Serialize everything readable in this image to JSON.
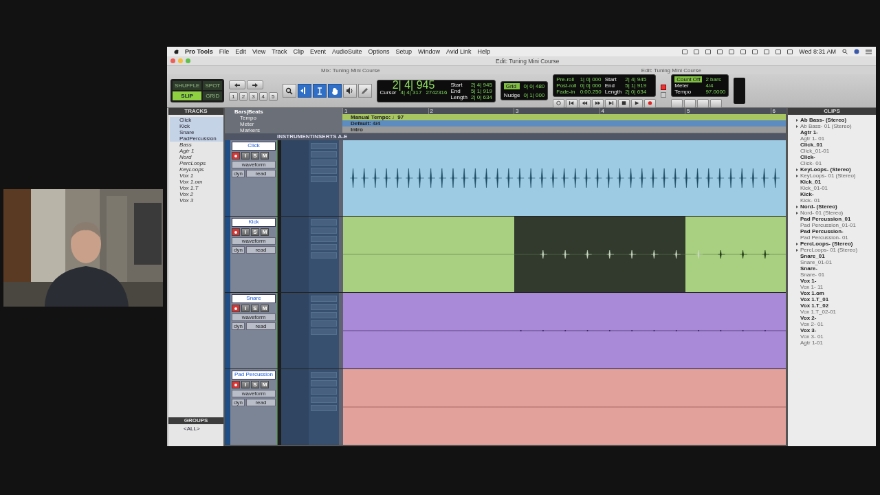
{
  "menubar": {
    "app": "Pro Tools",
    "menus": [
      "File",
      "Edit",
      "View",
      "Track",
      "Clip",
      "Event",
      "AudioSuite",
      "Options",
      "Setup",
      "Window",
      "Avid Link",
      "Help"
    ],
    "clock": "Wed 8:31 AM"
  },
  "window": {
    "title": "Edit: Tuning Mini Course",
    "mix_title": "Mix: Tuning Mini Course",
    "edit_title": "Edit: Tuning Mini Course"
  },
  "toolbar": {
    "modes": [
      {
        "label": "SHUFFLE",
        "selected": false
      },
      {
        "label": "SPOT",
        "selected": false
      },
      {
        "label": "SLIP",
        "selected": true
      },
      {
        "label": "GRID",
        "selected": false
      }
    ],
    "zoom_presets": [
      "1",
      "2",
      "3",
      "4",
      "5"
    ],
    "tools": [
      {
        "kind": "zoom",
        "selected": false
      },
      {
        "kind": "trim",
        "selected": true
      },
      {
        "kind": "selector",
        "selected": true
      },
      {
        "kind": "grabber",
        "selected": true
      },
      {
        "kind": "scrub",
        "selected": false
      },
      {
        "kind": "pencil",
        "selected": false
      }
    ],
    "counter": {
      "main": "2| 4| 945",
      "start_label": "Start",
      "end_label": "End",
      "length_label": "Length",
      "start": "2| 4| 945",
      "end": "5| 1| 919",
      "length": "2| 0| 634",
      "cursor_label": "Cursor",
      "cursor": "4| 4| 317",
      "samples": "2742316"
    },
    "grid": {
      "grid_label": "Grid",
      "grid_on": true,
      "grid": "0| 0| 480",
      "nudge_label": "Nudge",
      "nudge": "0| 1| 000"
    },
    "transport": {
      "preroll_label": "Pre-roll",
      "preroll": "1| 0| 000",
      "postroll_label": "Post-roll",
      "postroll": "0| 0| 000",
      "fadein_label": "Fade-in",
      "fadein": "0:00.250",
      "start_label": "Start",
      "start": "2| 4| 945",
      "end_label": "End",
      "end": "5| 1| 919",
      "length_label": "Length",
      "length": "2| 0| 634"
    },
    "midi": {
      "countoff_label": "Count Off",
      "countoff": "2 bars",
      "meter_label": "Meter",
      "meter": "4/4",
      "tempo_label": "Tempo",
      "tempo": "97.0000"
    }
  },
  "tracks_panel": {
    "title": "TRACKS",
    "items": [
      {
        "name": "Click",
        "selected": true
      },
      {
        "name": "Kick",
        "selected": true
      },
      {
        "name": "Snare",
        "selected": true
      },
      {
        "name": "PadPercussion",
        "selected": true
      },
      {
        "name": "Bass",
        "selected": false
      },
      {
        "name": "Agtr 1",
        "selected": false
      },
      {
        "name": "Nord",
        "selected": false
      },
      {
        "name": "PercLoops",
        "selected": false
      },
      {
        "name": "KeyLoops",
        "selected": false
      },
      {
        "name": "Vox 1",
        "selected": false
      },
      {
        "name": "Vox 1.om",
        "selected": false
      },
      {
        "name": "Vox 1.T",
        "selected": false
      },
      {
        "name": "Vox 2",
        "selected": false
      },
      {
        "name": "Vox 3",
        "selected": false
      }
    ]
  },
  "groups_panel": {
    "title": "GROUPS",
    "items": [
      "<ALL>"
    ]
  },
  "rulers": {
    "labels": [
      "Bars|Beats",
      "Tempo",
      "Meter",
      "Markers"
    ],
    "bars": [
      "1",
      "2",
      "3",
      "4",
      "5",
      "6"
    ],
    "tempo_marker": "Manual Tempo: ♩97",
    "meter_marker": "Default: 4/4",
    "marker": "Intro"
  },
  "columns": [
    "INSTRUMENT",
    "INSERTS A-E"
  ],
  "tracks": [
    {
      "name": "Click",
      "color": "#9dcbe3",
      "kind": "click",
      "view": "waveform",
      "automation": "dyn",
      "mode": "read",
      "buttons": [
        "I",
        "S",
        "M"
      ],
      "segments": [
        {
          "selected": false
        },
        {
          "selected": false
        },
        {
          "selected": false
        },
        {
          "selected": false
        },
        {
          "selected": false
        },
        {
          "selected": false
        }
      ]
    },
    {
      "name": "Kick",
      "color": "#a8d080",
      "kind": "kick",
      "view": "waveform",
      "automation": "dyn",
      "mode": "read",
      "buttons": [
        "I",
        "S",
        "M"
      ],
      "segments": [
        {
          "selected": false
        },
        {
          "selected": false
        },
        {
          "selected": true
        },
        {
          "selected": true
        },
        {
          "selected": false
        },
        {
          "selected": false
        }
      ]
    },
    {
      "name": "Snare",
      "color": "#a98ad8",
      "kind": "snare",
      "view": "waveform",
      "automation": "dyn",
      "mode": "read",
      "buttons": [
        "I",
        "S",
        "M"
      ],
      "segments": [
        {
          "selected": false
        },
        {
          "selected": false
        },
        {
          "selected": false
        },
        {
          "selected": false
        },
        {
          "selected": false
        },
        {
          "selected": false
        }
      ]
    },
    {
      "name": "Pad Percussion",
      "color": "#e3a19b",
      "kind": "pad",
      "view": "waveform",
      "automation": "dyn",
      "mode": "read",
      "buttons": [
        "I",
        "S",
        "M"
      ],
      "segments": [
        {
          "selected": false
        },
        {
          "selected": false
        },
        {
          "selected": false
        },
        {
          "selected": false
        },
        {
          "selected": false
        },
        {
          "selected": false
        }
      ]
    }
  ],
  "clips_panel": {
    "title": "CLIPS",
    "items": [
      {
        "name": "Ab Bass- (Stereo)",
        "kind": "whole",
        "expandable": true
      },
      {
        "name": "Ab Bass- 01 (Stereo)",
        "kind": "sub",
        "expandable": true
      },
      {
        "name": "Agtr 1-",
        "kind": "whole",
        "expandable": false
      },
      {
        "name": "Agtr 1- 01",
        "kind": "sub",
        "expandable": false
      },
      {
        "name": "Click_01",
        "kind": "whole",
        "expandable": false
      },
      {
        "name": "Click_01-01",
        "kind": "sub",
        "expandable": false
      },
      {
        "name": "Click-",
        "kind": "whole",
        "expandable": false
      },
      {
        "name": "Click- 01",
        "kind": "sub",
        "expandable": false
      },
      {
        "name": "KeyLoops- (Stereo)",
        "kind": "whole",
        "expandable": true
      },
      {
        "name": "KeyLoops- 01 (Stereo)",
        "kind": "sub",
        "expandable": true
      },
      {
        "name": "Kick_01",
        "kind": "whole",
        "expandable": false
      },
      {
        "name": "Kick_01-01",
        "kind": "sub",
        "expandable": false
      },
      {
        "name": "Kick-",
        "kind": "whole",
        "expandable": false
      },
      {
        "name": "Kick- 01",
        "kind": "sub",
        "expandable": false
      },
      {
        "name": "Nord- (Stereo)",
        "kind": "whole",
        "expandable": true
      },
      {
        "name": "Nord- 01 (Stereo)",
        "kind": "sub",
        "expandable": true
      },
      {
        "name": "Pad Percussion_01",
        "kind": "whole",
        "expandable": false
      },
      {
        "name": "Pad Percussion_01-01",
        "kind": "sub",
        "expandable": false
      },
      {
        "name": "Pad Percussion-",
        "kind": "whole",
        "expandable": false
      },
      {
        "name": "Pad Percussion- 01",
        "kind": "sub",
        "expandable": false
      },
      {
        "name": "PercLoops- (Stereo)",
        "kind": "whole",
        "expandable": true
      },
      {
        "name": "PercLoops- 01 (Stereo)",
        "kind": "sub",
        "expandable": true
      },
      {
        "name": "Snare_01",
        "kind": "whole",
        "expandable": false
      },
      {
        "name": "Snare_01-01",
        "kind": "sub",
        "expandable": false
      },
      {
        "name": "Snare-",
        "kind": "whole",
        "expandable": false
      },
      {
        "name": "Snare- 01",
        "kind": "sub",
        "expandable": false
      },
      {
        "name": "Vox 1-",
        "kind": "whole",
        "expandable": false
      },
      {
        "name": "Vox 1- 11",
        "kind": "sub",
        "expandable": false
      },
      {
        "name": "Vox 1.om",
        "kind": "whole",
        "expandable": false
      },
      {
        "name": "Vox 1.T_01",
        "kind": "whole",
        "expandable": false
      },
      {
        "name": "Vox 1.T_02",
        "kind": "whole",
        "expandable": false
      },
      {
        "name": "Vox 1.T_02-01",
        "kind": "sub",
        "expandable": false
      },
      {
        "name": "Vox 2-",
        "kind": "whole",
        "expandable": false
      },
      {
        "name": "Vox 2- 01",
        "kind": "sub",
        "expandable": false
      },
      {
        "name": "Vox 3-",
        "kind": "whole",
        "expandable": false
      },
      {
        "name": "Vox 3- 01",
        "kind": "sub",
        "expandable": false
      },
      {
        "name": "Agtr 1-01",
        "kind": "sub",
        "expandable": false
      }
    ]
  },
  "webcam": {
    "kind": "picture"
  }
}
